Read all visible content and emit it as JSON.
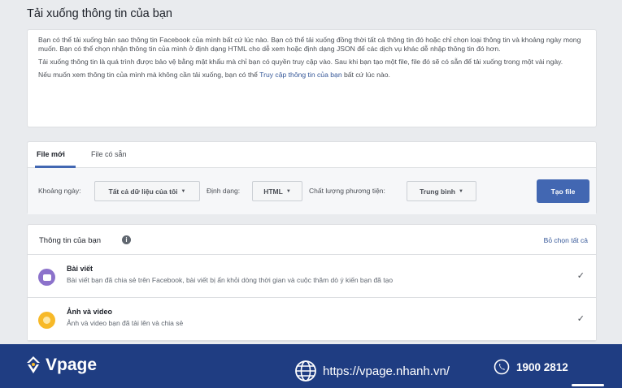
{
  "page": {
    "title": "Tải xuống thông tin của bạn"
  },
  "intro": {
    "p1": "Bạn có thể tải xuống bản sao thông tin Facebook của mình bất cứ lúc nào. Bạn có thể tải xuống đồng thời tất cả thông tin đó hoặc chỉ chọn loại thông tin và khoảng ngày mong muốn. Bạn có thể chọn nhận thông tin của mình ở định dạng HTML cho dễ xem hoặc định dạng JSON để các dịch vụ khác dễ nhập thông tin đó hơn.",
    "p2": "Tải xuống thông tin là quá trình được bảo vệ bằng mật khẩu mà chỉ bạn có quyền truy cập vào. Sau khi bạn tạo một file, file đó sẽ có sẵn để tải xuống trong một vài ngày.",
    "p3_prefix": "Nếu muốn xem thông tin của mình mà không cần tải xuống, bạn có thể ",
    "p3_link": "Truy cập thông tin của bạn",
    "p3_suffix": " bất cứ lúc nào."
  },
  "tabs": {
    "new_file": "File mới",
    "available_files": "File có sẵn"
  },
  "controls": {
    "date_range_label": "Khoảng ngày:",
    "date_range_value": "Tất cả dữ liệu của tôi",
    "format_label": "Định dạng:",
    "format_value": "HTML",
    "media_quality_label": "Chất lượng phương tiện:",
    "media_quality_value": "Trung bình",
    "create_button": "Tạo file"
  },
  "info": {
    "title": "Thông tin của bạn",
    "info_icon_glyph": "i",
    "deselect_all": "Bỏ chọn tất cả",
    "items": [
      {
        "title": "Bài viết",
        "description": "Bài viết bạn đã chia sẻ trên Facebook, bài viết bị ẩn khỏi dòng thời gian và cuộc thăm dò ý kiến bạn đã tạo",
        "icon": "posts-icon",
        "icon_color": "#8c72cb",
        "checked": true
      },
      {
        "title": "Ảnh và video",
        "description": "Ảnh và video bạn đã tải lên và chia sẻ",
        "icon": "photos-icon",
        "icon_color": "#f7b928",
        "checked": true
      }
    ]
  },
  "footer": {
    "brand": "Vpage",
    "url": "https://vpage.nhanh.vn/",
    "phone": "1900 2812",
    "background": "#1f3d82"
  }
}
